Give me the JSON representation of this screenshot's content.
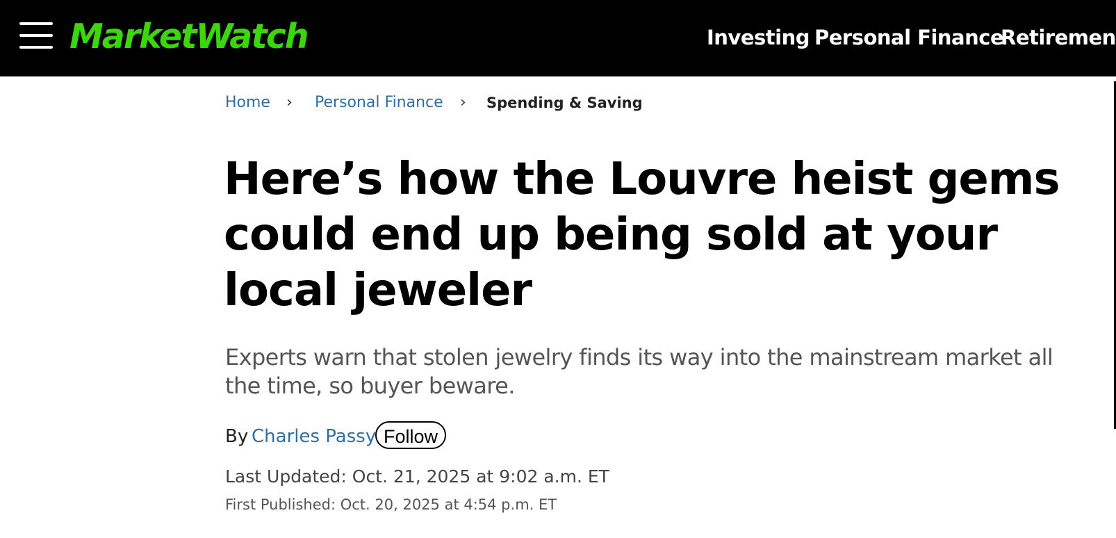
{
  "header": {
    "logo": "MarketWatch",
    "menu_icon": "hamburger-menu-icon",
    "nav": [
      "Investing",
      "Personal Finance",
      "Retirement"
    ],
    "background": "#000000",
    "logo_color": "#3cd70a"
  },
  "breadcrumb": {
    "home": "Home",
    "section": "Personal Finance",
    "current": "Spending & Saving",
    "separator_icon": "chevron-right-icon",
    "link_color": "#2d6fa5"
  },
  "article": {
    "headline": "Here’s how the Louvre heist gems could end up being sold at your local jeweler",
    "dek": "Experts warn that stolen jewelry finds its way into the mainstream market all the time, so buyer beware.",
    "byline_prefix": "By",
    "author": "Charles Passy",
    "follow_label": "Follow",
    "last_updated": "Last Updated: Oct. 21, 2025 at 9:02 a.m. ET",
    "first_published": "First Published: Oct. 20, 2025 at 4:54 p.m. ET"
  }
}
